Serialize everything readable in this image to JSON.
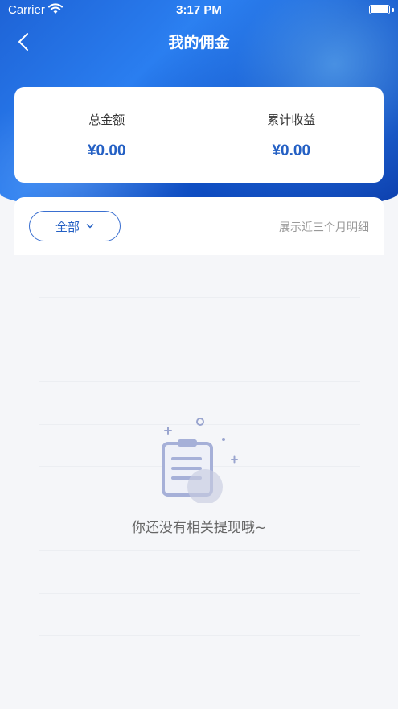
{
  "status": {
    "carrier": "Carrier",
    "time": "3:17 PM"
  },
  "nav": {
    "title": "我的佣金",
    "back_icon": "chevron-left-icon"
  },
  "summary": [
    {
      "label": "总金额",
      "value": "¥0.00"
    },
    {
      "label": "累计收益",
      "value": "¥0.00"
    }
  ],
  "filter": {
    "label": "全部",
    "hint": "展示近三个月明细"
  },
  "empty": {
    "message": "你还没有相关提现哦~",
    "icon": "empty-clipboard-icon"
  },
  "colors": {
    "accent": "#2460c4",
    "header": "#1e63d6",
    "background": "#f5f6f9"
  }
}
